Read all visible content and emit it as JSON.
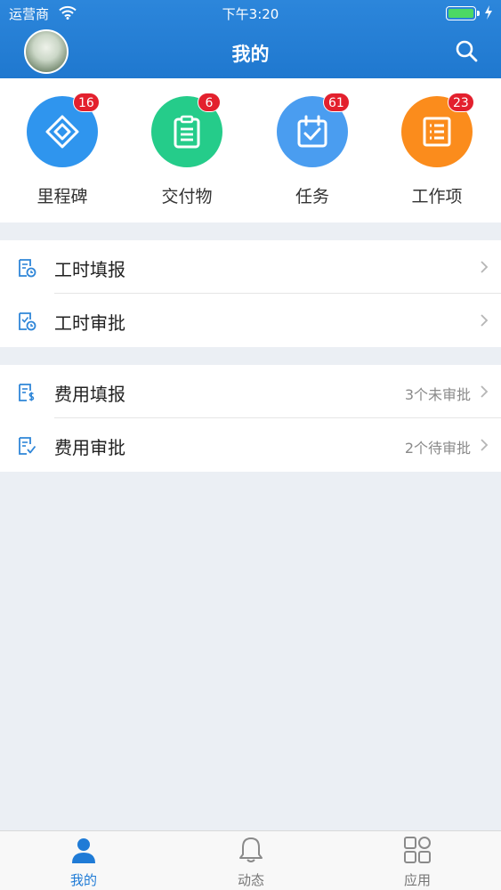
{
  "status": {
    "carrier": "运营商",
    "time": "下午3:20"
  },
  "header": {
    "title": "我的"
  },
  "shortcuts": [
    {
      "label": "里程碑",
      "badge": "16",
      "icon": "milestone-icon",
      "color": "#2f95ee"
    },
    {
      "label": "交付物",
      "badge": "6",
      "icon": "clipboard-icon",
      "color": "#25cc8a"
    },
    {
      "label": "任务",
      "badge": "61",
      "icon": "calendar-check-icon",
      "color": "#4a9df0"
    },
    {
      "label": "工作项",
      "badge": "23",
      "icon": "list-icon",
      "color": "#fb8c1c"
    }
  ],
  "groups": [
    {
      "rows": [
        {
          "label": "工时填报",
          "status": "",
          "icon": "timesheet-entry-icon"
        },
        {
          "label": "工时审批",
          "status": "",
          "icon": "timesheet-approval-icon"
        }
      ]
    },
    {
      "rows": [
        {
          "label": "费用填报",
          "status": "3个未审批",
          "icon": "expense-entry-icon"
        },
        {
          "label": "费用审批",
          "status": "2个待审批",
          "icon": "expense-approval-icon"
        }
      ]
    }
  ],
  "tabs": [
    {
      "label": "我的",
      "icon": "person-icon",
      "active": true
    },
    {
      "label": "动态",
      "icon": "bell-icon",
      "active": false
    },
    {
      "label": "应用",
      "icon": "grid-icon",
      "active": false
    }
  ],
  "colors": {
    "accent": "#1f7bd6",
    "header": "#2c86db",
    "badge": "#e3202d",
    "background": "#ebeff4"
  }
}
